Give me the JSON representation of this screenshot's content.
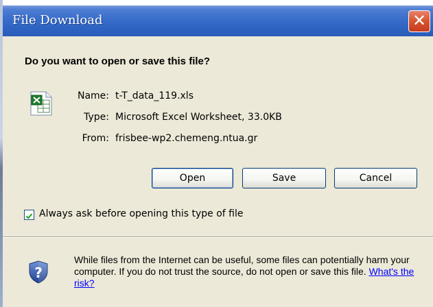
{
  "window": {
    "title": "File Download",
    "close_glyph": "✕"
  },
  "dialog": {
    "question": "Do you want to open or save this file?",
    "file_icon": "excel-file-icon",
    "name_label": "Name:",
    "name_value": "t-T_data_119.xls",
    "type_label": "Type:",
    "type_value": "Microsoft Excel Worksheet, 33.0KB",
    "from_label": "From:",
    "from_value": "frisbee-wp2.chemeng.ntua.gr"
  },
  "buttons": {
    "open": "Open",
    "save": "Save",
    "cancel": "Cancel"
  },
  "checkbox": {
    "label": "Always ask before opening this type of file",
    "checked": true
  },
  "warning": {
    "icon": "shield-question-icon",
    "text": "While files from the Internet can be useful, some files can potentially harm your computer. If you do not trust the source, do not open or save this file.",
    "link": "What's the risk?"
  },
  "colors": {
    "titlebar": "#2f64c4",
    "dialog_background": "#ece9d8",
    "close_button": "#d9532f",
    "link": "#0000ff"
  }
}
